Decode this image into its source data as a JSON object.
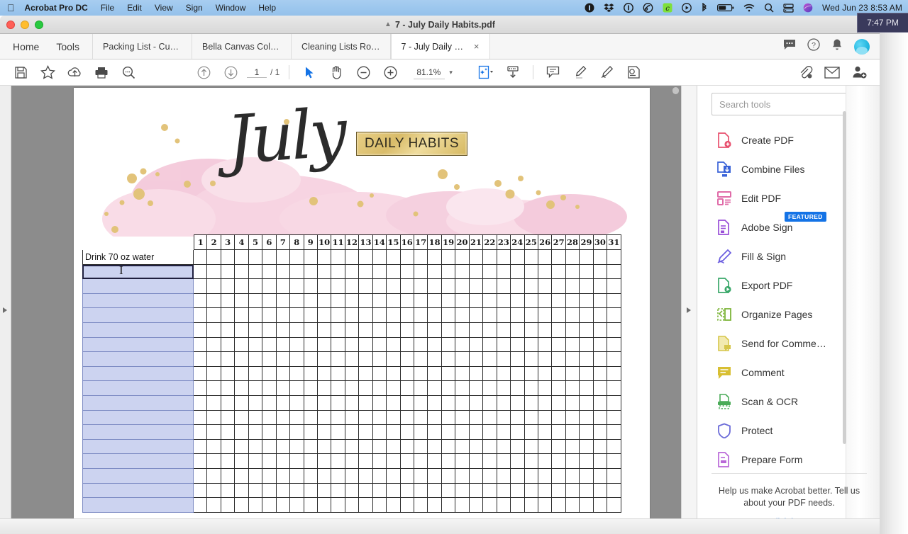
{
  "menubar": {
    "apple_icon": "apple-logo",
    "items": [
      "Acrobat Pro DC",
      "File",
      "Edit",
      "View",
      "Sign",
      "Window",
      "Help"
    ],
    "status_icons": [
      "1password-icon",
      "dropbox-icon",
      "onepassword-circle-icon",
      "cloud-link-icon",
      "evernote-icon",
      "play-circle-icon",
      "bluetooth-icon",
      "battery-icon",
      "wifi-icon",
      "spotlight-search-icon",
      "display-icon",
      "siri-icon"
    ],
    "clock": "Wed Jun 23  8:53 AM"
  },
  "overlay": {
    "clock": "7:47 PM"
  },
  "window": {
    "title": "7 - July Daily Habits.pdf"
  },
  "tabstrip": {
    "home_label": "Home",
    "tools_label": "Tools",
    "tabs": [
      {
        "label": "Packing List - Cus…",
        "active": false
      },
      {
        "label": "Bella Canvas Colo…",
        "active": false
      },
      {
        "label": "Cleaning Lists Ro…",
        "active": false
      },
      {
        "label": "7 - July Daily Habi…",
        "active": true,
        "close": "×"
      }
    ],
    "icons": [
      "comment-balloon-icon",
      "help-circle-icon",
      "bell-icon",
      "account-avatar"
    ]
  },
  "toolbar": {
    "left_icons": [
      "save-icon",
      "star-icon",
      "upload-cloud-icon",
      "print-icon",
      "zoom-search-icon"
    ],
    "nav_icons": [
      "previous-page-icon",
      "next-page-icon"
    ],
    "page_current": "1",
    "page_total": "/ 1",
    "tool_icons": [
      "select-cursor-icon",
      "hand-tool-icon",
      "zoom-out-icon",
      "zoom-in-icon"
    ],
    "zoom_level": "81.1%",
    "zoom_caret": "▾",
    "mid_icons": [
      "enhance-scans-icon",
      "download-form-icon"
    ],
    "annot_icons": [
      "sticky-note-icon",
      "highlighter-icon",
      "draw-signature-icon",
      "stamp-icon"
    ],
    "right_icons": [
      "attach-file-icon",
      "email-icon",
      "share-person-icon"
    ]
  },
  "document": {
    "title_script": "July",
    "badge": "DAILY HABITS",
    "days": [
      "1",
      "2",
      "3",
      "4",
      "5",
      "6",
      "7",
      "8",
      "9",
      "10",
      "11",
      "12",
      "13",
      "14",
      "15",
      "16",
      "17",
      "18",
      "19",
      "20",
      "21",
      "22",
      "23",
      "24",
      "25",
      "26",
      "27",
      "28",
      "29",
      "30",
      "31"
    ],
    "rows": [
      {
        "label": "Drink 70 oz water",
        "type": "filled",
        "focused": false
      },
      {
        "label": "",
        "type": "field",
        "focused": true
      },
      {
        "label": "",
        "type": "field",
        "focused": false
      },
      {
        "label": "",
        "type": "field",
        "focused": false
      },
      {
        "label": "",
        "type": "field",
        "focused": false
      },
      {
        "label": "",
        "type": "field",
        "focused": false
      },
      {
        "label": "",
        "type": "field",
        "focused": false
      },
      {
        "label": "",
        "type": "field",
        "focused": false
      },
      {
        "label": "",
        "type": "field",
        "focused": false
      },
      {
        "label": "",
        "type": "field",
        "focused": false
      },
      {
        "label": "",
        "type": "field",
        "focused": false
      },
      {
        "label": "",
        "type": "field",
        "focused": false
      },
      {
        "label": "",
        "type": "field",
        "focused": false
      },
      {
        "label": "",
        "type": "field",
        "focused": false
      },
      {
        "label": "",
        "type": "field",
        "focused": false
      },
      {
        "label": "",
        "type": "field",
        "focused": false
      },
      {
        "label": "",
        "type": "field",
        "focused": false
      },
      {
        "label": "",
        "type": "field",
        "focused": false
      }
    ]
  },
  "tools_panel": {
    "search_placeholder": "Search tools",
    "search_value": "",
    "items": [
      {
        "label": "Create PDF",
        "icon": "create-pdf-icon",
        "color": "#e8506e",
        "badge": ""
      },
      {
        "label": "Combine Files",
        "icon": "combine-files-icon",
        "color": "#3a63d8",
        "badge": ""
      },
      {
        "label": "Edit PDF",
        "icon": "edit-pdf-icon",
        "color": "#e06ba8",
        "badge": ""
      },
      {
        "label": "Adobe Sign",
        "icon": "adobe-sign-icon",
        "color": "#9a4fd8",
        "badge": "FEATURED"
      },
      {
        "label": "Fill & Sign",
        "icon": "fill-sign-icon",
        "color": "#6b5de0",
        "badge": ""
      },
      {
        "label": "Export PDF",
        "icon": "export-pdf-icon",
        "color": "#3aa86a",
        "badge": ""
      },
      {
        "label": "Organize Pages",
        "icon": "organize-pages-icon",
        "color": "#7db53a",
        "badge": ""
      },
      {
        "label": "Send for Comme…",
        "icon": "send-comments-icon",
        "color": "#d6c64a",
        "badge": ""
      },
      {
        "label": "Comment",
        "icon": "comment-icon",
        "color": "#d8bf33",
        "badge": ""
      },
      {
        "label": "Scan & OCR",
        "icon": "scan-ocr-icon",
        "color": "#4aab58",
        "badge": ""
      },
      {
        "label": "Protect",
        "icon": "protect-shield-icon",
        "color": "#6b6bd8",
        "badge": ""
      },
      {
        "label": "Prepare Form",
        "icon": "prepare-form-icon",
        "color": "#b968d8",
        "badge": ""
      }
    ],
    "footer_text": "Help us make Acrobat better. Tell us about your PDF needs.",
    "footer_link": "Click here"
  },
  "colors": {
    "accent_blue": "#1473e6",
    "menubar": "#9dc7ee",
    "field_fill": "#ccd3f0",
    "page_bg": "#8c8c8c"
  }
}
